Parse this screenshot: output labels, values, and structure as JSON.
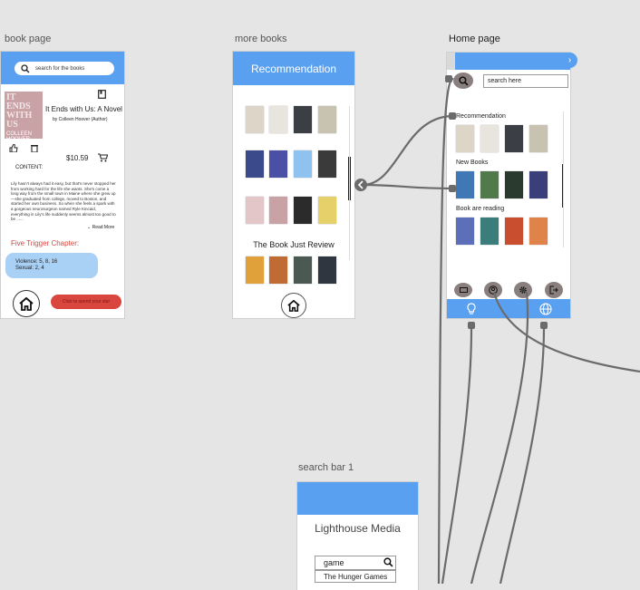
{
  "frames": {
    "book_page": "book page",
    "more_books": "more books",
    "home_page": "Home page",
    "search_bar_1": "search bar 1"
  },
  "book_page": {
    "search_placeholder": "search for the books",
    "book_title": "It Ends with Us: A Novel",
    "author": "by Colleen Hoover (Author)",
    "cover_text": "IT ENDS WITH US",
    "cover_author": "COLLEEN HOOVER",
    "price": "$10.59",
    "content_label": "CONTENT:",
    "description": "Lily hasn't always had it easy, but that's never stopped her from working hard for the life she wants. She's come a long way from the small town in Maine where she grew up—she graduated from college, moved to Boston, and started her own business. So when she feels a spark with a gorgeous neurosurgeon named Ryle Kincaid, everything in Lily's life suddenly seems almost too good to be ......",
    "read_more": "Read More",
    "trigger_heading": "Five Trigger Chapter:",
    "trigger_lines": [
      "Violence: 5, 8, 16",
      "Sexual: 2, 4"
    ],
    "red_button": "Click to spend your star"
  },
  "more_books": {
    "header": "Recommendation",
    "section": "The Book Just Review"
  },
  "home_page": {
    "search_placeholder": "search here",
    "sections": [
      "Recommendation",
      "New Books",
      "Book are reading"
    ],
    "bottom_icons": [
      "gift-icon",
      "user-icon",
      "gear-icon",
      "logout-icon"
    ],
    "footer_icons": [
      "lightbulb-icon",
      "globe-icon"
    ]
  },
  "search_bar": {
    "title": "Lighthouse Media",
    "query": "game",
    "result": "The Hunger Games"
  },
  "colors": {
    "accent": "#5aa0f0",
    "trigger_red": "#d9463e",
    "pill": "#a9d0f5",
    "wire": "#6b6b6b"
  }
}
